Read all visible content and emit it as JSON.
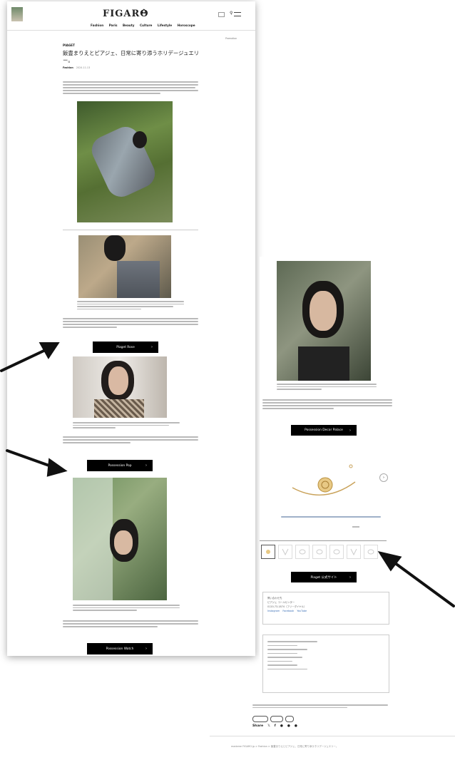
{
  "header": {
    "brand": "FIGARO",
    "nav": [
      "Fashion",
      "Paris",
      "Beauty",
      "Culture",
      "Lifestyle",
      "Horoscope"
    ]
  },
  "article": {
    "tag": "Promotion",
    "brand_label": "PIAGET",
    "title": "飯豊まりえとピアジェ、日常に寄り添うホリデージュエリー。",
    "category": "Fashion",
    "date": "2024.11.13"
  },
  "buttons": {
    "rose": "Piaget Rose",
    "possession_pop": "Possession Pop",
    "possession_watch": "Possession Watch",
    "possession_decor": "Possession Decor Palace",
    "official_site": "Piaget 公式サイト"
  },
  "footer": {
    "contact_title": "問い合わせ先",
    "contact_name": "ピアジェ コールセンター",
    "contact_tel": "0120-73-1874（フリーダイヤル）",
    "links": [
      "Instagram",
      "Facebook",
      "YouTube"
    ],
    "share_label": "Share"
  },
  "breadcrumb": [
    "madame FIGARO.jp",
    "Fashion",
    "飯豊まりえとピアジェ、日常に寄り添うホリデージュエリー。"
  ]
}
